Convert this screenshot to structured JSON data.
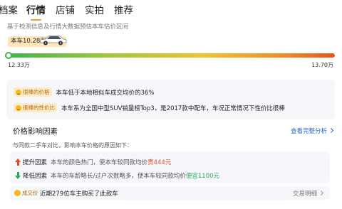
{
  "nav": {
    "tabs": [
      {
        "label": "档案",
        "active": false
      },
      {
        "label": "行情",
        "active": true
      },
      {
        "label": "店铺",
        "active": false
      },
      {
        "label": "实拍",
        "active": false
      },
      {
        "label": "推荐",
        "active": false
      }
    ]
  },
  "valuation": {
    "subtitle": "基于检测信息及行情大数据预估本车估价区间",
    "price_chip": "本车10.28万",
    "range_min": "12.33万",
    "range_max": "13.70万"
  },
  "highlights": [
    {
      "badge": "很棒的价格",
      "text": "本车低于本地相似车成交均价的36%"
    },
    {
      "badge": "很棒的性价比",
      "text": "本车系为全国中型SUV销量榜Top3，是2017款中配车，车况正常情况下性价比很棒"
    }
  ],
  "factors": {
    "title": "价格影响因素",
    "link": "查看完整分析",
    "desc": "与同款二手车对比，影响本车价格的原因如下：",
    "items": [
      {
        "label": "提升因素",
        "desc": "本车的颜色热门，使本车较同款均价",
        "value": "贵444元",
        "direction": "up"
      },
      {
        "label": "降低因素",
        "desc": "本车的车龄略长/过户次数略多，使本车较同款均价",
        "value": "便宜1100元",
        "direction": "down"
      }
    ]
  },
  "deals": {
    "badge": "成交价",
    "text": "近期279位车主购买了此款车",
    "link": "交易明细"
  },
  "colors": {
    "accent": "#f0a020",
    "up": "#e04a2a",
    "down": "#2ea855",
    "link": "#2b66c9"
  }
}
